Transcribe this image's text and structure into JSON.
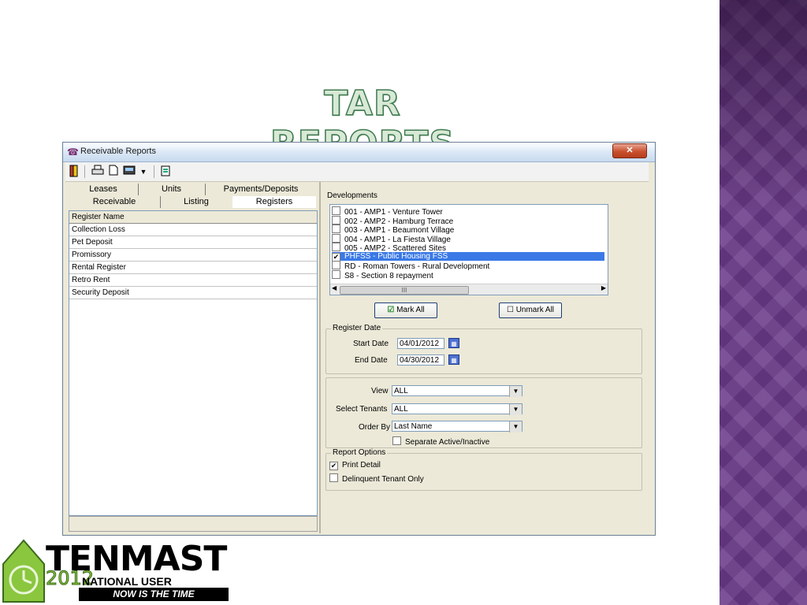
{
  "slide": {
    "title": "TAR REPORTS"
  },
  "window": {
    "title": "Receivable Reports",
    "close_glyph": "✕"
  },
  "toolbar": {
    "icons": [
      "exit-icon",
      "print-icon",
      "preview-icon",
      "export-icon",
      "dropdown-arrow-icon",
      "options-icon"
    ]
  },
  "tabs": {
    "row1": [
      "Leases",
      "Units",
      "Payments/Deposits"
    ],
    "row2": [
      "Receivable",
      "Listing",
      "Registers"
    ],
    "active": "Registers"
  },
  "registers": {
    "header": "Register Name",
    "items": [
      "Collection Loss",
      "Pet Deposit",
      "Promissory",
      "Rental Register",
      "Retro Rent",
      "Security Deposit"
    ]
  },
  "developments": {
    "label": "Developments",
    "items": [
      {
        "text": "001 - AMP1 - Venture Tower",
        "checked": false,
        "selected": false
      },
      {
        "text": "002 - AMP2 - Hamburg Terrace",
        "checked": false,
        "selected": false
      },
      {
        "text": "003 - AMP1 - Beaumont Village",
        "checked": false,
        "selected": false
      },
      {
        "text": "004 - AMP1 - La Fiesta Village",
        "checked": false,
        "selected": false
      },
      {
        "text": "005 - AMP2 - Scattered Sites",
        "checked": false,
        "selected": false
      },
      {
        "text": "PHFSS - Public Housing FSS",
        "checked": true,
        "selected": true
      },
      {
        "text": "RD - Roman Towers - Rural Development",
        "checked": false,
        "selected": false
      },
      {
        "text": "S8 - Section 8 repayment",
        "checked": false,
        "selected": false
      }
    ],
    "scroll_thumb": "III",
    "mark_all": "Mark All",
    "unmark_all": "Unmark All"
  },
  "register_date": {
    "legend": "Register Date",
    "start_label": "Start Date",
    "start_value": "04/01/2012",
    "end_label": "End Date",
    "end_value": "04/30/2012"
  },
  "filters": {
    "view_label": "View",
    "view_value": "ALL",
    "tenants_label": "Select Tenants",
    "tenants_value": "ALL",
    "order_label": "Order By",
    "order_value": "Last Name",
    "separate_label": "Separate Active/Inactive",
    "separate_checked": false
  },
  "report_options": {
    "legend": "Report Options",
    "print_detail_label": "Print Detail",
    "print_detail_checked": true,
    "delinquent_label": "Delinquent Tenant Only",
    "delinquent_checked": false
  },
  "logo": {
    "wordmark": "TENMAST",
    "year": "2012",
    "conference": "NATIONAL USER CONFERENCE",
    "tagline": "NOW IS THE TIME"
  },
  "colors": {
    "accent_purple": "#6a3a88",
    "selection_blue": "#3a79e6",
    "title_green": "#3f7a4f"
  }
}
